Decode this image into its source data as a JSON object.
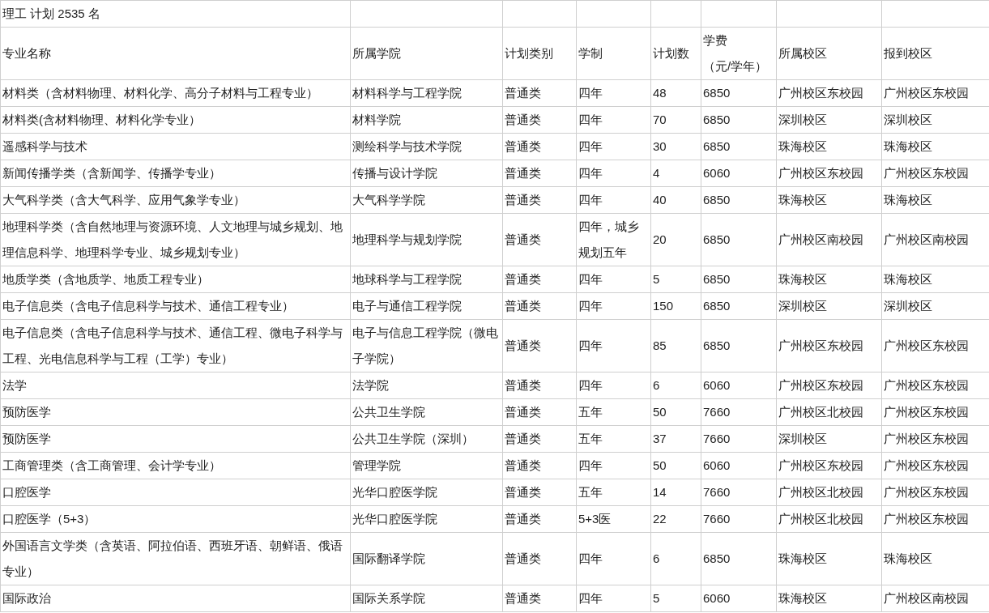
{
  "table": {
    "title": "理工 计划 2535 名",
    "columns": [
      "专业名称",
      "所属学院",
      "计划类别",
      "学制",
      "计划数",
      [
        "学费",
        "（元/学年）"
      ],
      "所属校区",
      "报到校区"
    ],
    "rows": [
      [
        "材料类（含材料物理、材料化学、高分子材料与工程专业）",
        "材料科学与工程学院",
        "普通类",
        "四年",
        "48",
        "6850",
        "广州校区东校园",
        "广州校区东校园"
      ],
      [
        "材料类(含材料物理、材料化学专业）",
        "材料学院",
        "普通类",
        "四年",
        "70",
        "6850",
        "深圳校区",
        "深圳校区"
      ],
      [
        "遥感科学与技术",
        "测绘科学与技术学院",
        "普通类",
        "四年",
        "30",
        "6850",
        "珠海校区",
        "珠海校区"
      ],
      [
        "新闻传播学类（含新闻学、传播学专业）",
        "传播与设计学院",
        "普通类",
        "四年",
        "4",
        "6060",
        "广州校区东校园",
        "广州校区东校园"
      ],
      [
        "大气科学类（含大气科学、应用气象学专业）",
        "大气科学学院",
        "普通类",
        "四年",
        "40",
        "6850",
        "珠海校区",
        "珠海校区"
      ],
      [
        "地理科学类（含自然地理与资源环境、人文地理与城乡规划、地理信息科学、地理科学专业、城乡规划专业）",
        "地理科学与规划学院",
        "普通类",
        "四年，城乡规划五年",
        "20",
        "6850",
        "广州校区南校园",
        "广州校区南校园"
      ],
      [
        "地质学类（含地质学、地质工程专业）",
        "地球科学与工程学院",
        "普通类",
        "四年",
        "5",
        "6850",
        "珠海校区",
        "珠海校区"
      ],
      [
        "电子信息类（含电子信息科学与技术、通信工程专业）",
        "电子与通信工程学院",
        "普通类",
        "四年",
        "150",
        "6850",
        "深圳校区",
        "深圳校区"
      ],
      [
        "电子信息类（含电子信息科学与技术、通信工程、微电子科学与工程、光电信息科学与工程（工学）专业）",
        "电子与信息工程学院（微电子学院）",
        "普通类",
        "四年",
        "85",
        "6850",
        "广州校区东校园",
        "广州校区东校园"
      ],
      [
        "法学",
        "法学院",
        "普通类",
        "四年",
        "6",
        "6060",
        "广州校区东校园",
        "广州校区东校园"
      ],
      [
        "预防医学",
        "公共卫生学院",
        "普通类",
        "五年",
        "50",
        "7660",
        "广州校区北校园",
        "广州校区东校园"
      ],
      [
        "预防医学",
        "公共卫生学院（深圳）",
        "普通类",
        "五年",
        "37",
        "7660",
        "深圳校区",
        "广州校区东校园"
      ],
      [
        "工商管理类（含工商管理、会计学专业）",
        "管理学院",
        "普通类",
        "四年",
        "50",
        "6060",
        "广州校区东校园",
        "广州校区东校园"
      ],
      [
        "口腔医学",
        "光华口腔医学院",
        "普通类",
        "五年",
        "14",
        "7660",
        "广州校区北校园",
        "广州校区东校园"
      ],
      [
        "口腔医学（5+3）",
        "光华口腔医学院",
        "普通类",
        "5+3医",
        "22",
        "7660",
        "广州校区北校园",
        "广州校区东校园"
      ],
      [
        "外国语言文学类（含英语、阿拉伯语、西班牙语、朝鲜语、俄语专业）",
        "国际翻译学院",
        "普通类",
        "四年",
        "6",
        "6850",
        "珠海校区",
        "珠海校区"
      ],
      [
        "国际政治",
        "国际关系学院",
        "普通类",
        "四年",
        "5",
        "6060",
        "珠海校区",
        "广州校区南校园"
      ]
    ]
  }
}
